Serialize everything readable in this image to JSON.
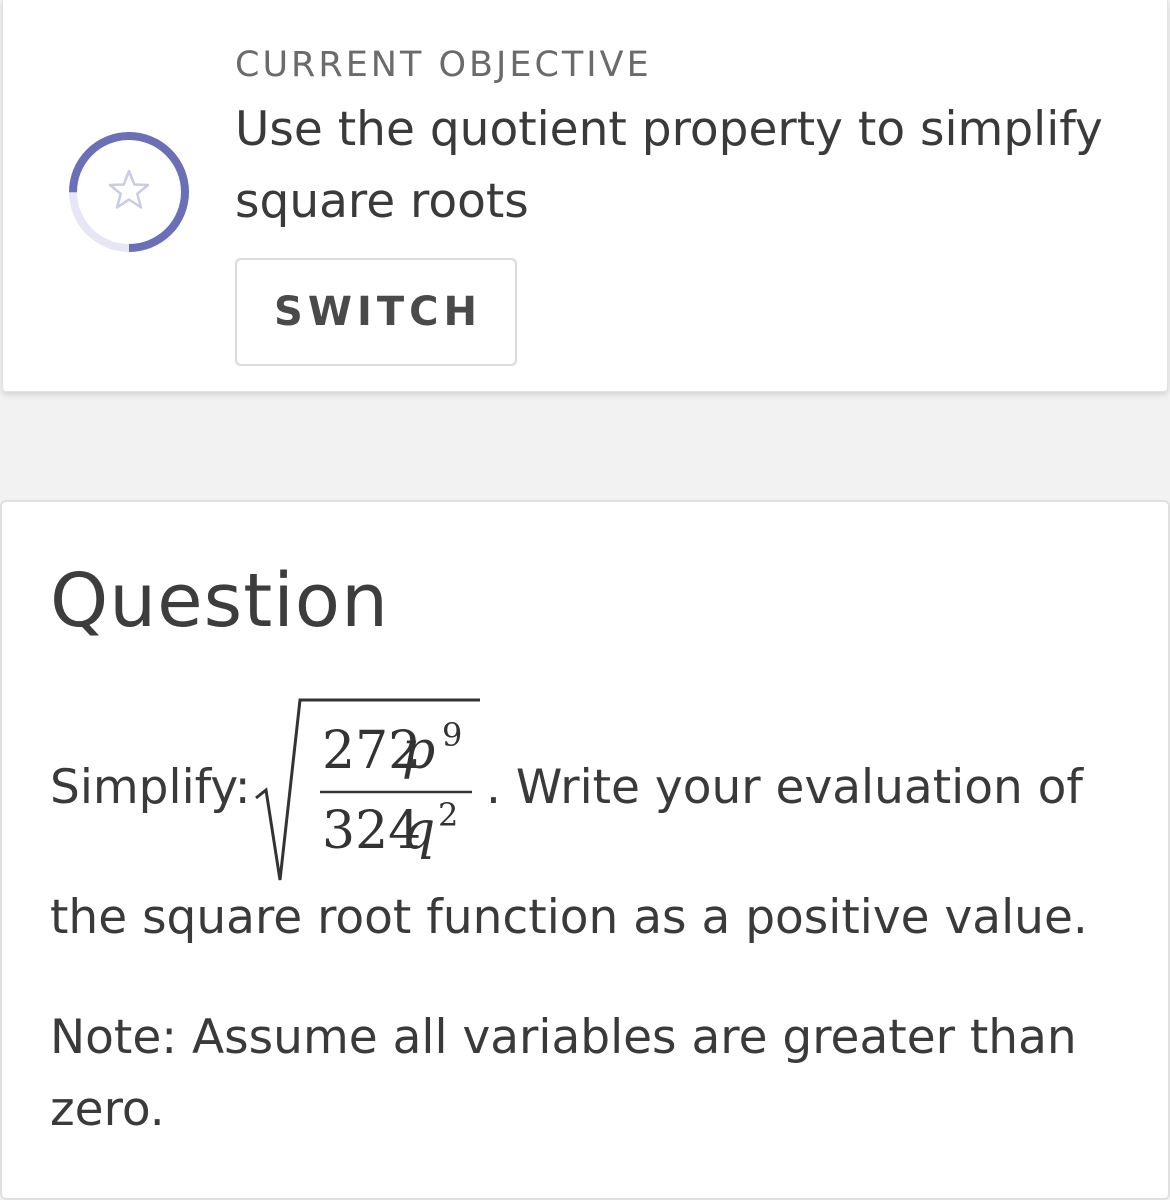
{
  "objective": {
    "label": "CURRENT OBJECTIVE",
    "title_line1": "Use the quotient property to simplify",
    "title_line2": "square roots",
    "switch_label": "SWITCH",
    "progress_icon": "star-icon",
    "progress": 0.75,
    "accent_color": "#6b6fb5"
  },
  "question": {
    "heading": "Question",
    "prefix": "Simplify:",
    "expression": {
      "numerator_coef": "272",
      "numerator_var": "p",
      "numerator_exp": "9",
      "denominator_coef": "324",
      "denominator_var": "q",
      "denominator_exp": "2"
    },
    "after_expression": ". Write your evaluation of",
    "line2": "the square root function as a positive value.",
    "note_line1": "Note: Assume all variables are greater than",
    "note_line2": "zero."
  }
}
